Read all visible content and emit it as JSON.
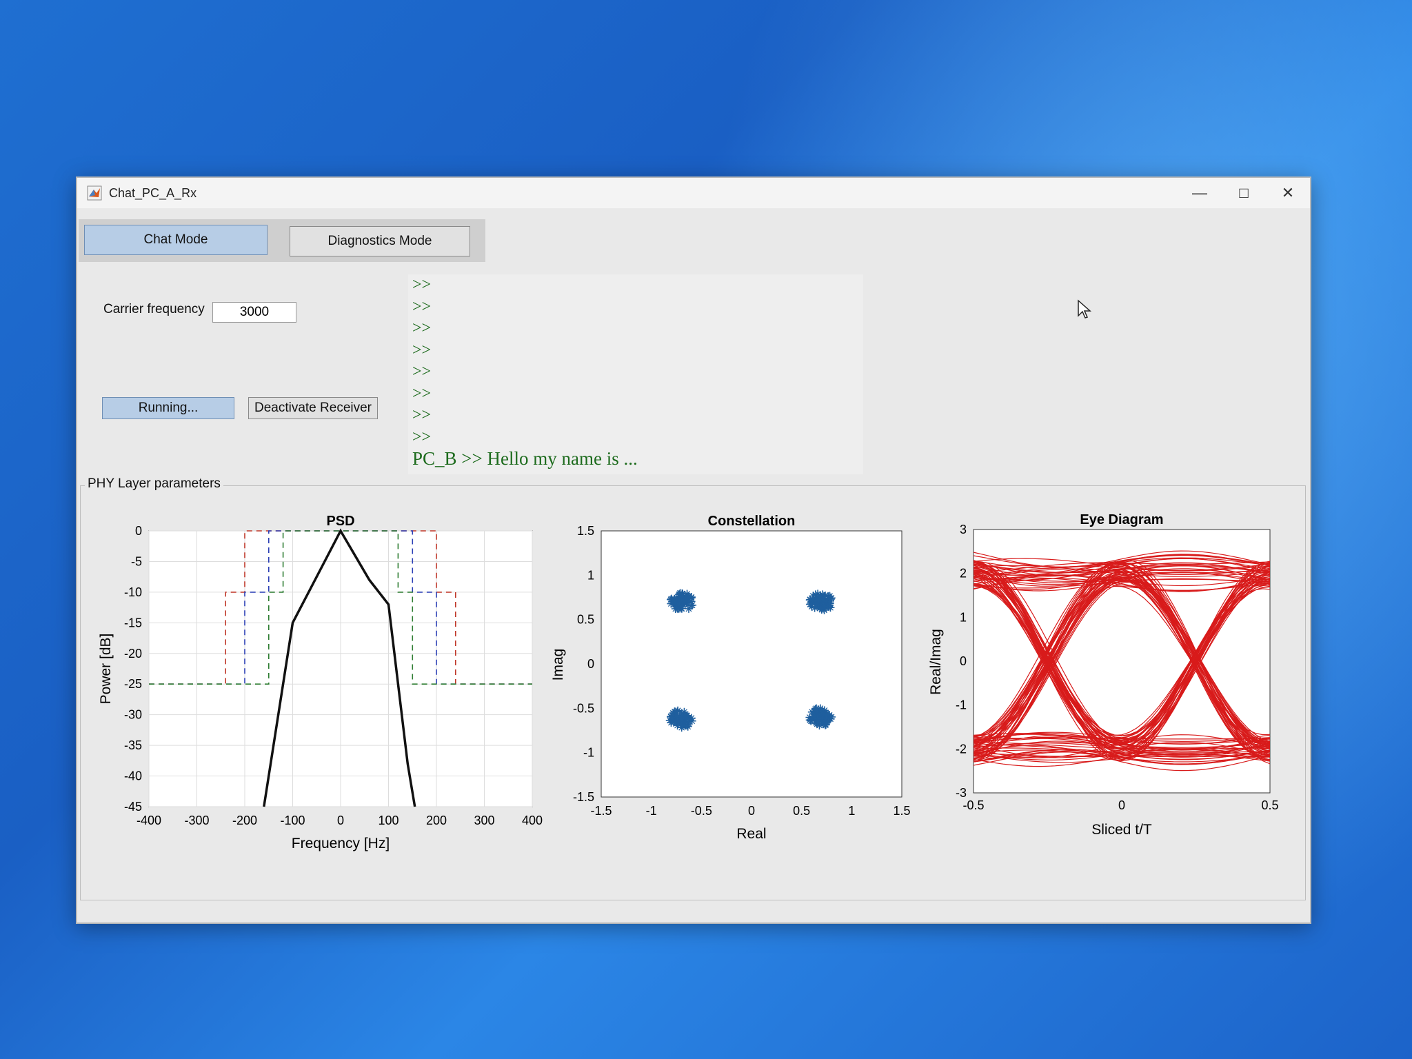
{
  "window": {
    "title": "Chat_PC_A_Rx",
    "controls": [
      "—",
      "□",
      "✕"
    ]
  },
  "tabs": {
    "chat": "Chat Mode",
    "diagnostics": "Diagnostics Mode"
  },
  "carrier": {
    "label": "Carrier frequency",
    "value": "3000"
  },
  "receiver": {
    "status": "Running...",
    "deactivate": "Deactivate Receiver"
  },
  "console": {
    "prompts": [
      ">>",
      ">>",
      ">>",
      ">>",
      ">>",
      ">>",
      ">>",
      ">>"
    ],
    "message": "PC_B >> Hello my name is ..."
  },
  "panel": {
    "title": "PHY Layer parameters"
  },
  "colors": {
    "console_text": "#1d6b1d",
    "psd_line": "#111111",
    "constellation": "#1f5f9e",
    "eye": "#d81b1b"
  },
  "chart_data": [
    {
      "type": "line",
      "title": "PSD",
      "xlabel": "Frequency [Hz]",
      "ylabel": "Power [dB]",
      "xlim": [
        -400,
        400
      ],
      "ylim": [
        -45,
        0
      ],
      "xticks": [
        "-400",
        "-300",
        "-200",
        "-100",
        "0",
        "100",
        "200",
        "300",
        "400"
      ],
      "yticks": [
        "0",
        "-5",
        "-10",
        "-15",
        "-20",
        "-25",
        "-30",
        "-35",
        "-40",
        "-45"
      ],
      "grid": true,
      "series": [
        {
          "style": "solid",
          "color": "#111111",
          "points": [
            [
              -160,
              -45
            ],
            [
              -100,
              -15
            ],
            [
              -60,
              -9
            ],
            [
              0,
              0
            ],
            [
              60,
              -8
            ],
            [
              100,
              -12
            ],
            [
              140,
              -38
            ],
            [
              155,
              -45
            ]
          ]
        },
        {
          "style": "dashed",
          "color": "#c0392b",
          "points": [
            [
              -400,
              -25
            ],
            [
              -240,
              -25
            ],
            [
              -240,
              -10
            ],
            [
              -200,
              -10
            ],
            [
              -200,
              0
            ],
            [
              200,
              0
            ],
            [
              200,
              -10
            ],
            [
              240,
              -10
            ],
            [
              240,
              -25
            ],
            [
              400,
              -25
            ]
          ]
        },
        {
          "style": "dashed",
          "color": "#2b3fb5",
          "points": [
            [
              -400,
              -25
            ],
            [
              -200,
              -25
            ],
            [
              -200,
              -10
            ],
            [
              -150,
              -10
            ],
            [
              -150,
              0
            ],
            [
              150,
              0
            ],
            [
              150,
              -10
            ],
            [
              200,
              -10
            ],
            [
              200,
              -25
            ],
            [
              400,
              -25
            ]
          ]
        },
        {
          "style": "dashed",
          "color": "#2e7d32",
          "points": [
            [
              -400,
              -25
            ],
            [
              -150,
              -25
            ],
            [
              -150,
              -10
            ],
            [
              -120,
              -10
            ],
            [
              -120,
              0
            ],
            [
              120,
              0
            ],
            [
              120,
              -10
            ],
            [
              150,
              -10
            ],
            [
              150,
              -25
            ],
            [
              400,
              -25
            ]
          ]
        }
      ]
    },
    {
      "type": "scatter",
      "title": "Constellation",
      "xlabel": "Real",
      "ylabel": "Imag",
      "xlim": [
        -1.5,
        1.5
      ],
      "ylim": [
        -1.5,
        1.5
      ],
      "xticks": [
        "-1.5",
        "-1",
        "-0.5",
        "0",
        "0.5",
        "1",
        "1.5"
      ],
      "yticks": [
        "1.5",
        "1",
        "0.5",
        "0",
        "-0.5",
        "-1",
        "-1.5"
      ],
      "clusters": [
        [
          -0.7,
          0.7
        ],
        [
          0.7,
          0.7
        ],
        [
          -0.7,
          -0.62
        ],
        [
          0.68,
          -0.6
        ]
      ]
    },
    {
      "type": "line",
      "title": "Eye Diagram",
      "xlabel": "Sliced t/T",
      "ylabel": "Real/Imag",
      "xlim": [
        -0.5,
        0.5
      ],
      "ylim": [
        -3,
        3
      ],
      "xticks": [
        "-0.5",
        "0",
        "0.5"
      ],
      "yticks": [
        "3",
        "2",
        "1",
        "0",
        "-1",
        "-2",
        "-3"
      ],
      "levels": [
        2,
        -2
      ]
    }
  ]
}
